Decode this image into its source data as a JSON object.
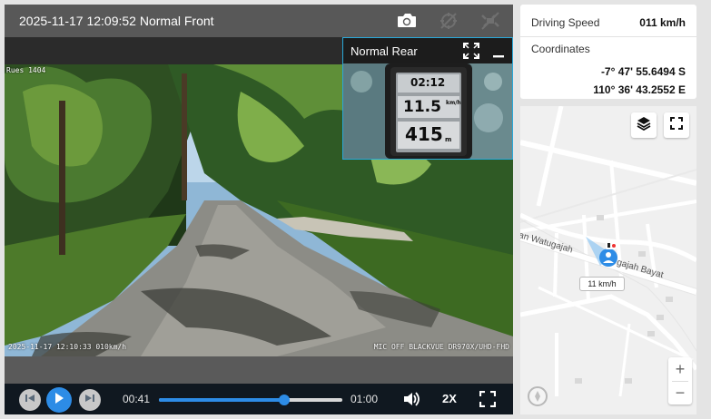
{
  "player": {
    "title": "2025-11-17 12:09:52 Normal Front",
    "osd": {
      "top_left": "Rues 1404",
      "bottom_left": "2025-11-17 12:10:33 010km/h",
      "bottom_right": "MIC OFF BLACKVUE DR970X/UHD-FHD"
    },
    "top_icons": [
      "camera-icon",
      "gps-disabled-icon",
      "satellite-disabled-icon"
    ]
  },
  "rear": {
    "title": "Normal Rear",
    "device_readout": {
      "time": "02:12",
      "speed": "11.5",
      "speed_unit": "km/h",
      "distance": "415",
      "distance_unit": "m"
    }
  },
  "controls": {
    "current_time": "00:41",
    "total_time": "01:00",
    "progress": 0.683,
    "playback_speed": "2X",
    "icons": [
      "previous-icon",
      "play-icon",
      "next-icon",
      "volume-icon",
      "fullscreen-icon"
    ]
  },
  "info": {
    "speed_label": "Driving Speed",
    "speed_value": "011 km/h",
    "coordinates_label": "Coordinates",
    "latitude": "-7° 47' 55.6494 S",
    "longitude": "110° 36' 43.2552 E"
  },
  "map": {
    "road_label": "an Watugajah",
    "road_label_2": "gajah Bayat",
    "speed_badge": "11 km/h",
    "zoom_in": "+",
    "zoom_out": "−",
    "colors": {
      "marker": "#2d8ce6",
      "road": "#ffffff",
      "background": "#f0f0f0"
    }
  },
  "colors": {
    "accent": "#2d8ce6",
    "top_bar": "#585858",
    "control_bar": "#101820"
  }
}
